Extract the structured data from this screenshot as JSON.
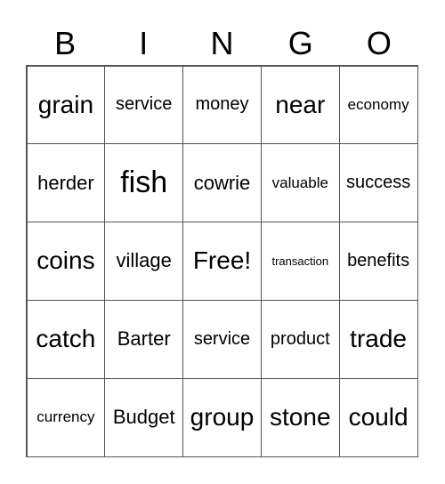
{
  "header": [
    "B",
    "I",
    "N",
    "G",
    "O"
  ],
  "cells": [
    {
      "text": "grain",
      "size": "l"
    },
    {
      "text": "service",
      "size": "s"
    },
    {
      "text": "money",
      "size": "s"
    },
    {
      "text": "near",
      "size": "l"
    },
    {
      "text": "economy",
      "size": "xs"
    },
    {
      "text": "herder",
      "size": "m"
    },
    {
      "text": "fish",
      "size": "xl"
    },
    {
      "text": "cowrie",
      "size": "m"
    },
    {
      "text": "valuable",
      "size": "xs"
    },
    {
      "text": "success",
      "size": "s"
    },
    {
      "text": "coins",
      "size": "l"
    },
    {
      "text": "village",
      "size": "m"
    },
    {
      "text": "Free!",
      "size": "l"
    },
    {
      "text": "transaction",
      "size": "xxs"
    },
    {
      "text": "benefits",
      "size": "s"
    },
    {
      "text": "catch",
      "size": "l"
    },
    {
      "text": "Barter",
      "size": "m"
    },
    {
      "text": "service",
      "size": "s"
    },
    {
      "text": "product",
      "size": "s"
    },
    {
      "text": "trade",
      "size": "l"
    },
    {
      "text": "currency",
      "size": "xs"
    },
    {
      "text": "Budget",
      "size": "m"
    },
    {
      "text": "group",
      "size": "l"
    },
    {
      "text": "stone",
      "size": "l"
    },
    {
      "text": "could",
      "size": "l"
    }
  ]
}
